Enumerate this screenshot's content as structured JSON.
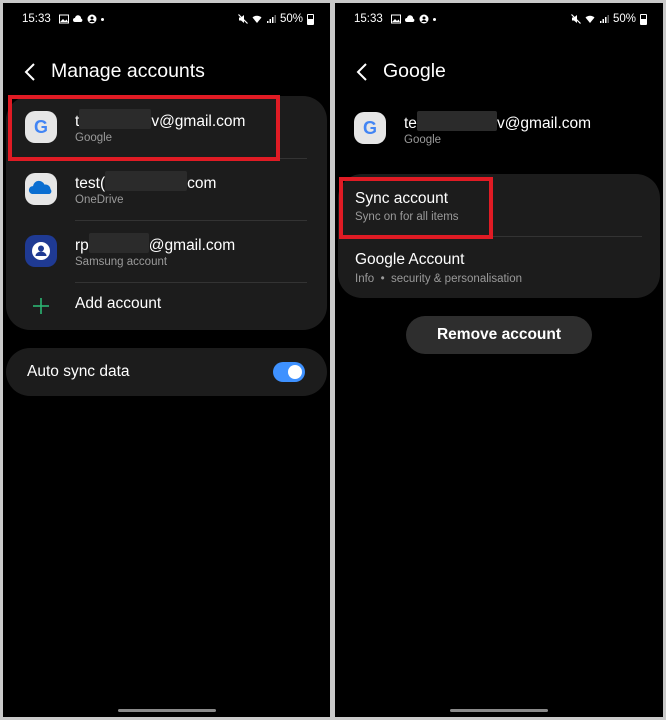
{
  "status": {
    "time": "15:33",
    "battery": "50%"
  },
  "left": {
    "title": "Manage accounts",
    "accounts": [
      {
        "prefix": "t",
        "suffix": "v@gmail.com",
        "type": "Google"
      },
      {
        "prefix": "test(",
        "suffix": "com",
        "type": "OneDrive"
      },
      {
        "prefix": "rp",
        "suffix": "@gmail.com",
        "type": "Samsung account"
      }
    ],
    "add_account": "Add account",
    "auto_sync_label": "Auto sync data",
    "auto_sync_on": true
  },
  "right": {
    "title": "Google",
    "account": {
      "prefix": "te",
      "suffix": "v@gmail.com",
      "type": "Google"
    },
    "sync_title": "Sync account",
    "sync_sub": "Sync on for all items",
    "google_title": "Google Account",
    "google_sub": "Info  •  security & personalisation",
    "remove_label": "Remove account"
  },
  "colors": {
    "accent_toggle": "#3e91ff",
    "highlight": "#e01b24",
    "card": "#1c1c1c",
    "add_plus": "#2bb673"
  }
}
